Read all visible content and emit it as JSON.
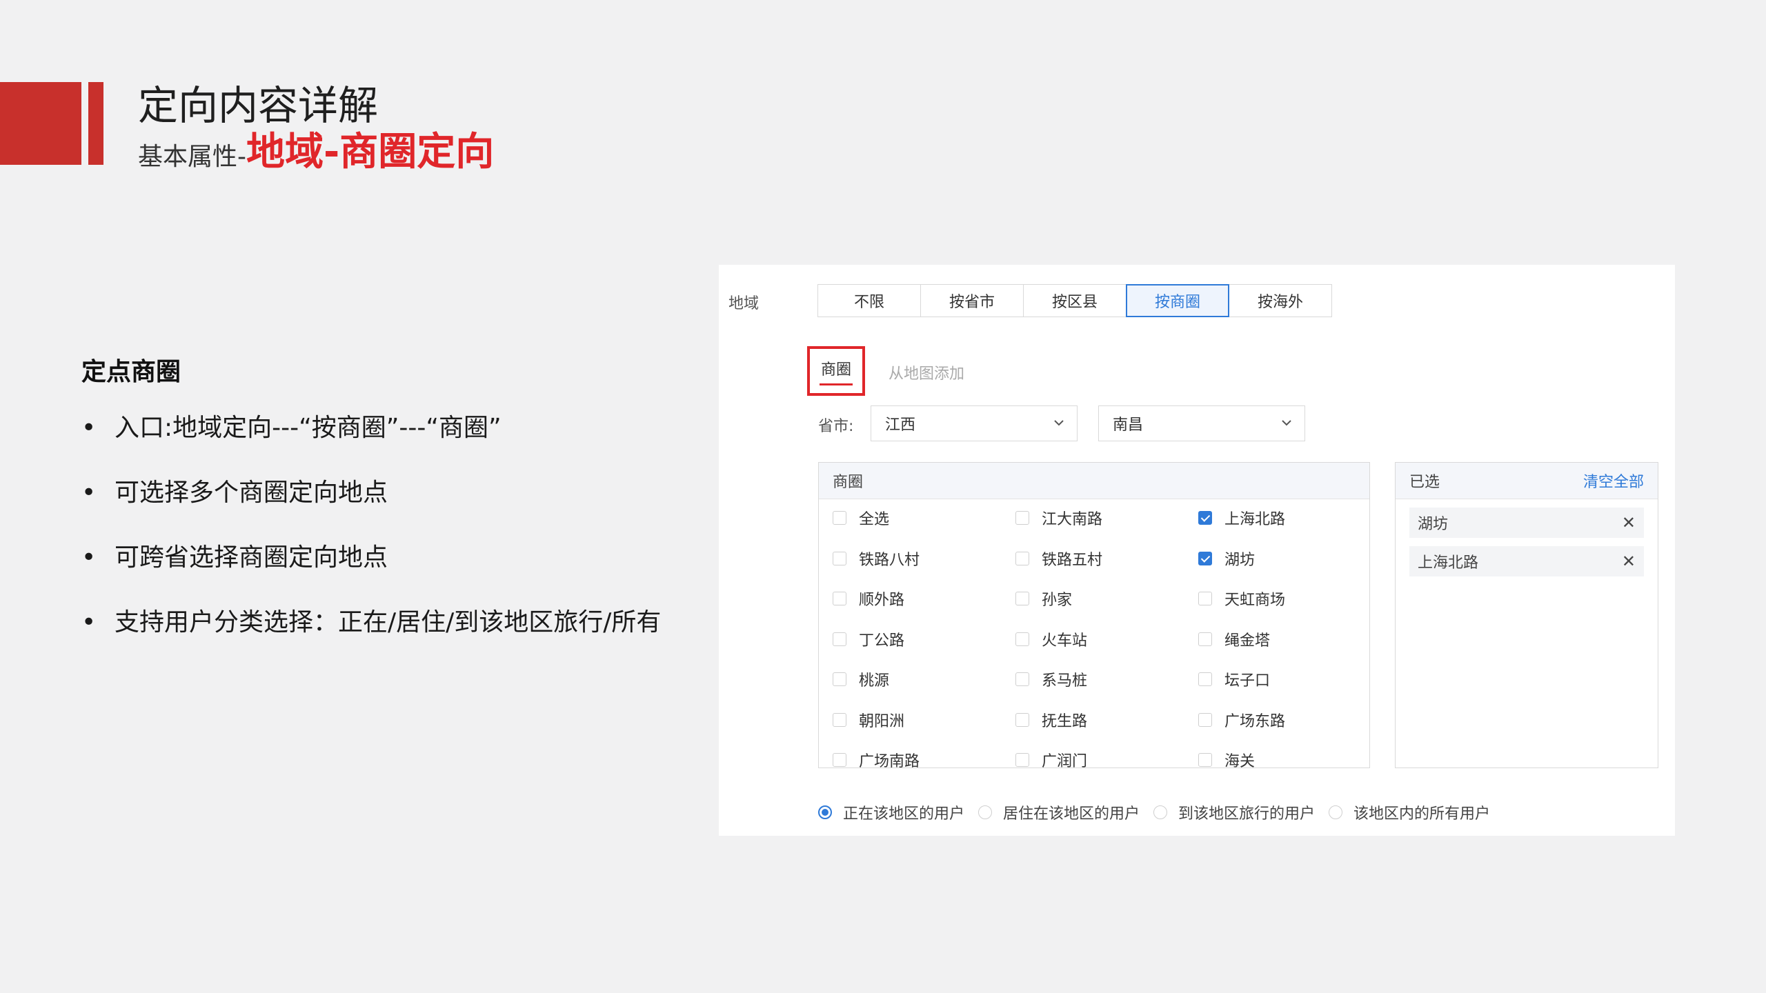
{
  "header": {
    "title": "定向内容详解",
    "subtitle_prefix": "基本属性-",
    "subtitle_highlight": "地域-商圈定向"
  },
  "left": {
    "section_title": "定点商圈",
    "bullets": [
      "入口:地域定向---“按商圈”---“商圈”",
      "可选择多个商圈定向地点",
      "可跨省选择商圈定向地点",
      "支持用户分类选择：正在/居住/到该地区旅行/所有"
    ]
  },
  "panel": {
    "region_label": "地域",
    "tabs": [
      "不限",
      "按省市",
      "按区县",
      "按商圈",
      "按海外"
    ],
    "active_tab": "按商圈",
    "subtabs": [
      "商圈",
      "从地图添加"
    ],
    "province_label": "省市:",
    "province_value": "江西",
    "city_value": "南昌",
    "list_header": "商圈",
    "items": [
      {
        "label": "全选",
        "checked": false
      },
      {
        "label": "江大南路",
        "checked": false
      },
      {
        "label": "上海北路",
        "checked": true
      },
      {
        "label": "铁路八村",
        "checked": false
      },
      {
        "label": "铁路五村",
        "checked": false
      },
      {
        "label": "湖坊",
        "checked": true
      },
      {
        "label": "顺外路",
        "checked": false
      },
      {
        "label": "孙家",
        "checked": false
      },
      {
        "label": "天虹商场",
        "checked": false
      },
      {
        "label": "丁公路",
        "checked": false
      },
      {
        "label": "火车站",
        "checked": false
      },
      {
        "label": "绳金塔",
        "checked": false
      },
      {
        "label": "桃源",
        "checked": false
      },
      {
        "label": "系马桩",
        "checked": false
      },
      {
        "label": "坛子口",
        "checked": false
      },
      {
        "label": "朝阳洲",
        "checked": false
      },
      {
        "label": "抚生路",
        "checked": false
      },
      {
        "label": "广场东路",
        "checked": false
      },
      {
        "label": "广场南路",
        "checked": false
      },
      {
        "label": "广润门",
        "checked": false
      },
      {
        "label": "海关",
        "checked": false
      }
    ],
    "selected_header": "已选",
    "clear_all": "清空全部",
    "selected": [
      "湖坊",
      "上海北路"
    ],
    "radios": [
      {
        "label": "正在该地区的用户",
        "selected": true
      },
      {
        "label": "居住在该地区的用户",
        "selected": false
      },
      {
        "label": "到该地区旅行的用户",
        "selected": false
      },
      {
        "label": "该地区内的所有用户",
        "selected": false
      }
    ],
    "colors": {
      "accent": "#2f7ad8",
      "highlight": "#e0262a",
      "brand_red": "#c8302c"
    }
  }
}
